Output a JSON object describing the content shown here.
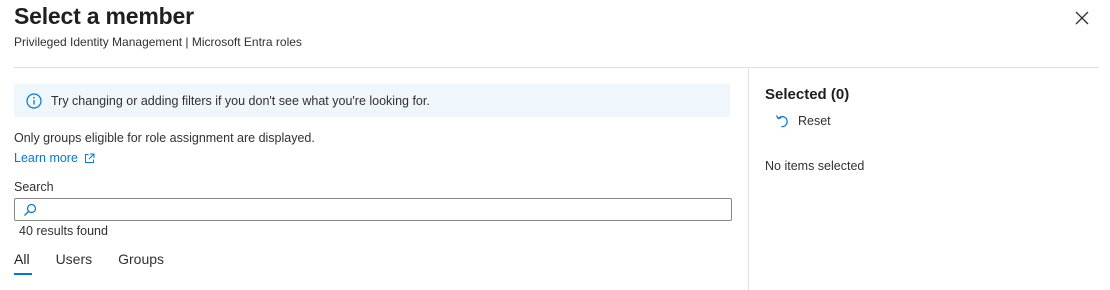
{
  "header": {
    "title": "Select a member",
    "subtitle": "Privileged Identity Management | Microsoft Entra roles",
    "close_icon": "close-icon"
  },
  "left_pane": {
    "info_banner": {
      "icon": "info-icon",
      "text": "Try changing or adding filters if you don't see what you're looking for."
    },
    "eligible_text": "Only groups eligible for role assignment are displayed.",
    "learn_more": {
      "label": "Learn more",
      "icon": "external-link-icon"
    },
    "search": {
      "label": "Search",
      "value": "",
      "placeholder": "",
      "icon": "search-icon"
    },
    "results_count": "40 results found",
    "tabs": [
      {
        "label": "All",
        "active": true
      },
      {
        "label": "Users",
        "active": false
      },
      {
        "label": "Groups",
        "active": false
      }
    ]
  },
  "right_pane": {
    "heading": "Selected (0)",
    "reset": {
      "label": "Reset",
      "icon": "reset-icon"
    },
    "empty_text": "No items selected"
  },
  "colors": {
    "accent": "#0078d4",
    "banner_bg": "#eff6fc",
    "divider": "#e1dfdd",
    "text": "#323130"
  }
}
